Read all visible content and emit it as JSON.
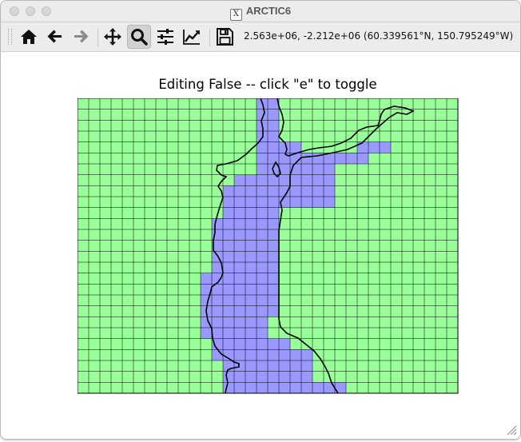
{
  "window": {
    "title": "ARCTIC6"
  },
  "toolbar": {
    "buttons": [
      {
        "name": "home-icon"
      },
      {
        "name": "back-arrow-icon"
      },
      {
        "name": "forward-arrow-icon"
      },
      {
        "name": "pan-move-icon"
      },
      {
        "name": "zoom-magnifier-icon",
        "active": true
      },
      {
        "name": "configure-subplots-icon"
      },
      {
        "name": "edit-axis-curves-icon"
      },
      {
        "name": "save-floppy-icon"
      }
    ],
    "coordinates": "2.563e+06, -2.212e+06 (60.339561°N, 150.795249°W)"
  },
  "figure": {
    "title": "Editing False -- click \"e\" to toggle"
  },
  "colors": {
    "land": "#99ff99",
    "water": "#9999ff",
    "grid": "#000000",
    "coastline": "#000000"
  }
}
